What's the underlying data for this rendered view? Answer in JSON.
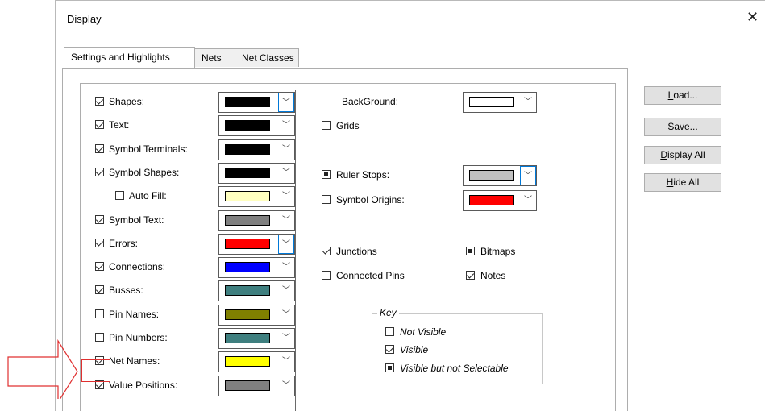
{
  "window": {
    "title": "Display",
    "close_icon": "close-icon"
  },
  "tabs": [
    {
      "label": "Settings and Highlights",
      "active": true
    },
    {
      "label": "Nets",
      "active": false
    },
    {
      "label": "Net Classes",
      "active": false
    }
  ],
  "left_items": [
    {
      "label": "Shapes:",
      "state": "checked",
      "color": "#000000",
      "focused": true
    },
    {
      "label": "Text:",
      "state": "checked",
      "color": "#000000"
    },
    {
      "label": "Symbol Terminals:",
      "state": "checked",
      "color": "#000000"
    },
    {
      "label": "Symbol Shapes:",
      "state": "checked",
      "color": "#000000"
    },
    {
      "label": "Auto Fill:",
      "state": "unchecked",
      "color": "#ffffc0",
      "indent": true
    },
    {
      "label": "Symbol Text:",
      "state": "checked",
      "color": "#808080"
    },
    {
      "label": "Errors:",
      "state": "checked",
      "color": "#ff0000",
      "focused": true
    },
    {
      "label": "Connections:",
      "state": "checked",
      "color": "#0000ff"
    },
    {
      "label": "Busses:",
      "state": "checked",
      "color": "#3f7f7f"
    },
    {
      "label": "Pin Names:",
      "state": "unchecked",
      "color": "#808000"
    },
    {
      "label": "Pin Numbers:",
      "state": "unchecked",
      "color": "#3f7f7f"
    },
    {
      "label": "Net Names:",
      "state": "checked",
      "color": "#ffff00"
    },
    {
      "label": "Value Positions:",
      "state": "checked",
      "color": "#808080"
    }
  ],
  "middle": {
    "background_label": "BackGround:",
    "background_color": "#ffffff",
    "grids_label": "Grids",
    "ruler_stops_label": "Ruler Stops:",
    "ruler_stops_color": "#c0c0c0",
    "symbol_origins_label": "Symbol Origins:",
    "symbol_origins_color": "#ff0000",
    "junctions_label": "Junctions",
    "bitmaps_label": "Bitmaps",
    "connected_pins_label": "Connected Pins",
    "notes_label": "Notes"
  },
  "key": {
    "title": "Key",
    "not_visible": "Not Visible",
    "visible": "Visible",
    "visible_not_selectable": "Visible but not Selectable"
  },
  "buttons": {
    "load": {
      "u": "L",
      "rest": "oad..."
    },
    "save": {
      "u": "S",
      "rest": "ave..."
    },
    "display_all": {
      "u": "D",
      "rest": "isplay All"
    },
    "hide_all": {
      "u": "H",
      "rest": "ide All"
    }
  },
  "annotation": {
    "arrow_color": "#e03030"
  }
}
